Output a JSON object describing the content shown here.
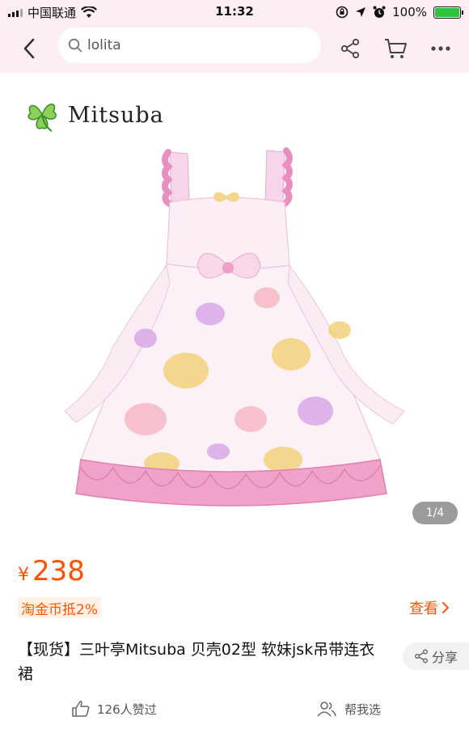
{
  "status_bar": {
    "carrier": "中国联通",
    "time": "11:32",
    "battery": "100%"
  },
  "nav": {
    "search_value": "lolita"
  },
  "gallery": {
    "brand": "Mitsuba",
    "page_indicator": "1/4"
  },
  "product": {
    "currency": "¥",
    "price": "238",
    "coin_tag": "淘金币抵2%",
    "view_link": "查看",
    "title": "【现货】三叶亭Mitsuba 贝壳02型 软妹jsk吊带连衣裙",
    "share_label": "分享",
    "likes": "126人赞过",
    "help_choose": "帮我选"
  },
  "colors": {
    "accent": "#ff5500",
    "price": "#ff4f00",
    "header_bg": "#fdeef5",
    "ruffle_pink": "#f0a3c8",
    "leaf_green": "#7cc24d"
  }
}
